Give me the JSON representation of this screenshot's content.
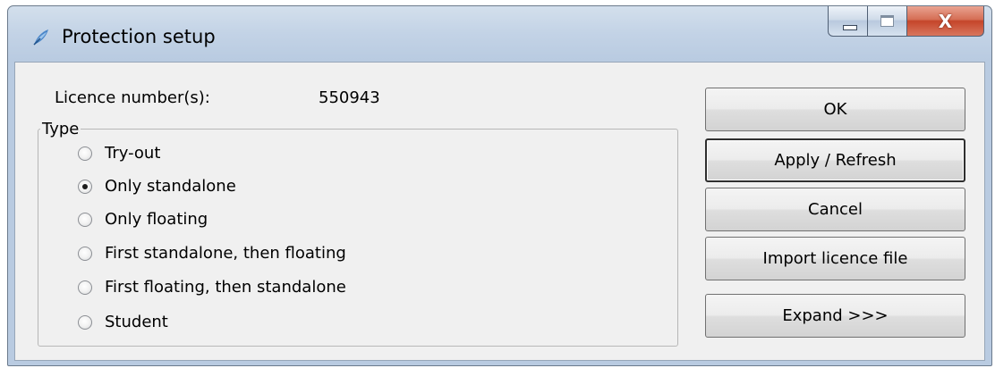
{
  "window": {
    "title": "Protection setup",
    "caption_buttons": {
      "minimize": "minimize",
      "maximize": "maximize",
      "close": "X"
    }
  },
  "licence": {
    "label": "Licence number(s):",
    "value": "550943"
  },
  "type_group": {
    "title": "Type",
    "selected_index": 1,
    "options": [
      {
        "label": "Try-out",
        "checked": false
      },
      {
        "label": "Only standalone",
        "checked": true
      },
      {
        "label": "Only floating",
        "checked": false
      },
      {
        "label": "First standalone, then floating",
        "checked": false
      },
      {
        "label": "First floating, then standalone",
        "checked": false
      },
      {
        "label": "Student",
        "checked": false
      }
    ]
  },
  "buttons": {
    "ok": "OK",
    "apply": "Apply / Refresh",
    "cancel": "Cancel",
    "import": "Import licence file",
    "expand": "Expand >>>"
  },
  "colors": {
    "titlebar": "#c3d3e6",
    "client_bg": "#f0f0f0",
    "close_button": "#c5452a"
  },
  "icons": [
    "feather-app-icon",
    "minimize-icon",
    "maximize-icon",
    "close-icon"
  ]
}
